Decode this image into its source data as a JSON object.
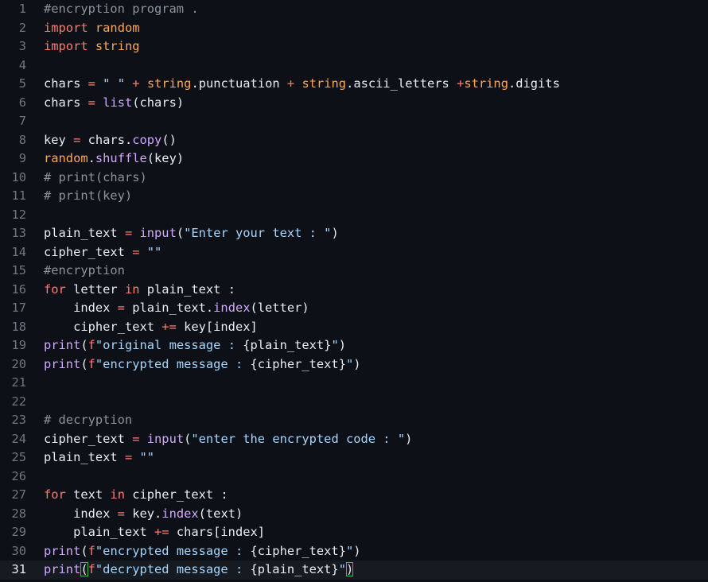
{
  "editor": {
    "lines": [
      {
        "n": "1",
        "tokens": [
          [
            "cm",
            "#encryption program ."
          ]
        ]
      },
      {
        "n": "2",
        "tokens": [
          [
            "kw",
            "import"
          ],
          [
            "pl",
            " "
          ],
          [
            "mod",
            "random"
          ]
        ]
      },
      {
        "n": "3",
        "tokens": [
          [
            "kw",
            "import"
          ],
          [
            "pl",
            " "
          ],
          [
            "mod",
            "string"
          ]
        ]
      },
      {
        "n": "4",
        "tokens": []
      },
      {
        "n": "5",
        "tokens": [
          [
            "pl",
            "chars "
          ],
          [
            "op",
            "="
          ],
          [
            "pl",
            " "
          ],
          [
            "str",
            "\" \""
          ],
          [
            "pl",
            " "
          ],
          [
            "op",
            "+"
          ],
          [
            "pl",
            " "
          ],
          [
            "mod",
            "string"
          ],
          [
            "pl",
            ".punctuation "
          ],
          [
            "op",
            "+"
          ],
          [
            "pl",
            " "
          ],
          [
            "mod",
            "string"
          ],
          [
            "pl",
            ".ascii_letters "
          ],
          [
            "op",
            "+"
          ],
          [
            "mod",
            "string"
          ],
          [
            "pl",
            ".digits"
          ]
        ]
      },
      {
        "n": "6",
        "tokens": [
          [
            "pl",
            "chars "
          ],
          [
            "op",
            "="
          ],
          [
            "pl",
            " "
          ],
          [
            "fn",
            "list"
          ],
          [
            "pl",
            "(chars)"
          ]
        ]
      },
      {
        "n": "7",
        "tokens": []
      },
      {
        "n": "8",
        "tokens": [
          [
            "pl",
            "key "
          ],
          [
            "op",
            "="
          ],
          [
            "pl",
            " chars."
          ],
          [
            "fn",
            "copy"
          ],
          [
            "pl",
            "()"
          ]
        ]
      },
      {
        "n": "9",
        "tokens": [
          [
            "mod",
            "random"
          ],
          [
            "pl",
            "."
          ],
          [
            "fn",
            "shuffle"
          ],
          [
            "pl",
            "(key)"
          ]
        ]
      },
      {
        "n": "10",
        "tokens": [
          [
            "cm",
            "# print(chars)"
          ]
        ]
      },
      {
        "n": "11",
        "tokens": [
          [
            "cm",
            "# print(key)"
          ]
        ]
      },
      {
        "n": "12",
        "tokens": []
      },
      {
        "n": "13",
        "tokens": [
          [
            "pl",
            "plain_text "
          ],
          [
            "op",
            "="
          ],
          [
            "pl",
            " "
          ],
          [
            "fn",
            "input"
          ],
          [
            "pl",
            "("
          ],
          [
            "str",
            "\"Enter your text : \""
          ],
          [
            "pl",
            ")"
          ]
        ]
      },
      {
        "n": "14",
        "tokens": [
          [
            "pl",
            "cipher_text "
          ],
          [
            "op",
            "="
          ],
          [
            "pl",
            " "
          ],
          [
            "str",
            "\"\""
          ]
        ]
      },
      {
        "n": "15",
        "tokens": [
          [
            "cm",
            "#encryption"
          ]
        ]
      },
      {
        "n": "16",
        "tokens": [
          [
            "kw",
            "for"
          ],
          [
            "pl",
            " letter "
          ],
          [
            "kw",
            "in"
          ],
          [
            "pl",
            " plain_text :"
          ]
        ]
      },
      {
        "n": "17",
        "tokens": [
          [
            "pl",
            "    index "
          ],
          [
            "op",
            "="
          ],
          [
            "pl",
            " plain_text."
          ],
          [
            "fn",
            "index"
          ],
          [
            "pl",
            "(letter)"
          ]
        ]
      },
      {
        "n": "18",
        "tokens": [
          [
            "pl",
            "    cipher_text "
          ],
          [
            "op",
            "+="
          ],
          [
            "pl",
            " key[index]"
          ]
        ]
      },
      {
        "n": "19",
        "tokens": [
          [
            "fn",
            "print"
          ],
          [
            "pl",
            "("
          ],
          [
            "kw",
            "f"
          ],
          [
            "str",
            "\"original message : "
          ],
          [
            "pl",
            "{plain_text}"
          ],
          [
            "str",
            "\""
          ],
          [
            "pl",
            ")"
          ]
        ]
      },
      {
        "n": "20",
        "tokens": [
          [
            "fn",
            "print"
          ],
          [
            "pl",
            "("
          ],
          [
            "kw",
            "f"
          ],
          [
            "str",
            "\"encrypted message : "
          ],
          [
            "pl",
            "{cipher_text}"
          ],
          [
            "str",
            "\""
          ],
          [
            "pl",
            ")"
          ]
        ]
      },
      {
        "n": "21",
        "tokens": []
      },
      {
        "n": "22",
        "tokens": []
      },
      {
        "n": "23",
        "tokens": [
          [
            "cm",
            "# decryption"
          ]
        ]
      },
      {
        "n": "24",
        "tokens": [
          [
            "pl",
            "cipher_text "
          ],
          [
            "op",
            "="
          ],
          [
            "pl",
            " "
          ],
          [
            "fn",
            "input"
          ],
          [
            "pl",
            "("
          ],
          [
            "str",
            "\"enter the encrypted code : \""
          ],
          [
            "pl",
            ")"
          ]
        ]
      },
      {
        "n": "25",
        "tokens": [
          [
            "pl",
            "plain_text "
          ],
          [
            "op",
            "="
          ],
          [
            "pl",
            " "
          ],
          [
            "str",
            "\"\""
          ]
        ]
      },
      {
        "n": "26",
        "tokens": []
      },
      {
        "n": "27",
        "tokens": [
          [
            "kw",
            "for"
          ],
          [
            "pl",
            " text "
          ],
          [
            "kw",
            "in"
          ],
          [
            "pl",
            " cipher_text :"
          ]
        ]
      },
      {
        "n": "28",
        "tokens": [
          [
            "pl",
            "    index "
          ],
          [
            "op",
            "="
          ],
          [
            "pl",
            " key."
          ],
          [
            "fn",
            "index"
          ],
          [
            "pl",
            "(text)"
          ]
        ]
      },
      {
        "n": "29",
        "tokens": [
          [
            "pl",
            "    plain_text "
          ],
          [
            "op",
            "+="
          ],
          [
            "pl",
            " chars[index]"
          ]
        ]
      },
      {
        "n": "30",
        "tokens": [
          [
            "fn",
            "print"
          ],
          [
            "pl",
            "("
          ],
          [
            "kw",
            "f"
          ],
          [
            "str",
            "\"encrypted message : "
          ],
          [
            "pl",
            "{cipher_text}"
          ],
          [
            "str",
            "\""
          ],
          [
            "pl",
            ")"
          ]
        ]
      },
      {
        "n": "31",
        "tokens": [
          [
            "fn",
            "print"
          ],
          [
            "brm",
            "("
          ],
          [
            "kw",
            "f"
          ],
          [
            "str",
            "\"decrypted message : "
          ],
          [
            "pl",
            "{plain_text}"
          ],
          [
            "str",
            "\""
          ],
          [
            "brm",
            ")"
          ]
        ],
        "current": true
      }
    ]
  }
}
